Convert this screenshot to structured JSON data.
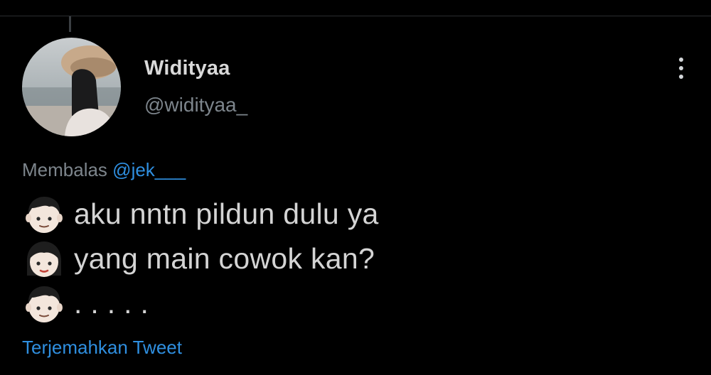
{
  "user": {
    "display_name": "Widityaa",
    "handle": "@widityaa_"
  },
  "reply": {
    "prefix": "Membalas",
    "mention": "@jek___"
  },
  "tweet": {
    "lines": [
      {
        "emoji": "boy-emoji",
        "text": "aku nntn pildun dulu ya"
      },
      {
        "emoji": "girl-emoji",
        "text": "yang main cowok kan?"
      },
      {
        "emoji": "boy-emoji",
        "text": ". . . . ."
      }
    ]
  },
  "translate_label": "Terjemahkan Tweet",
  "colors": {
    "background": "#000000",
    "text": "#d4d4d4",
    "muted": "#7d858c",
    "link": "#2f8fe0"
  }
}
